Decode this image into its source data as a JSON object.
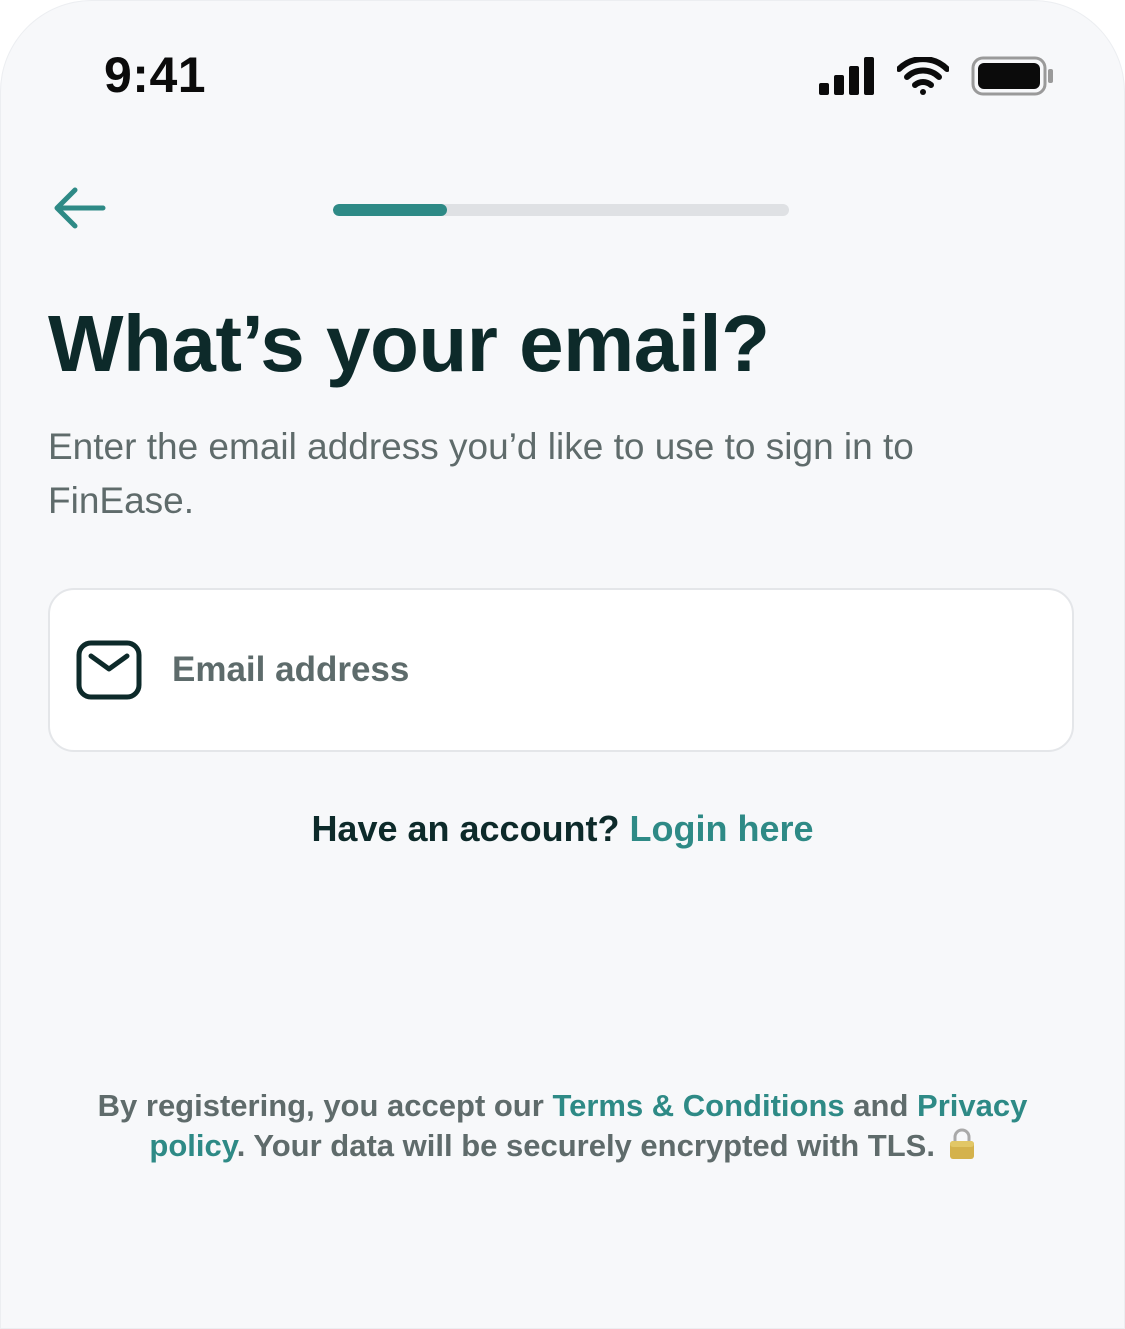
{
  "status_bar": {
    "time": "9:41",
    "icons": [
      "cellular-signal-icon",
      "wifi-icon",
      "battery-icon"
    ]
  },
  "nav": {
    "back_icon": "arrow-left-icon",
    "progress_fraction": 0.25
  },
  "heading": {
    "title": "What’s your email?",
    "subtitle": "Enter the email address you’d like to use to sign in to FinEase."
  },
  "email_field": {
    "icon": "mail-icon",
    "placeholder": "Email address",
    "value": ""
  },
  "login_prompt": {
    "text": "Have an account?",
    "link_label": "Login here"
  },
  "legal": {
    "prefix": "By registering, you accept our",
    "terms_label": "Terms & Conditions",
    "conjunction": "and",
    "privacy_label": "Privacy policy",
    "suffix": ". Your data will be securely encrypted with TLS.",
    "lock_icon": "lock-icon"
  },
  "colors": {
    "accent": "#2e8a86",
    "heading": "#0d2a2a",
    "muted": "#5f6b6b",
    "background": "#f7f8fa"
  }
}
